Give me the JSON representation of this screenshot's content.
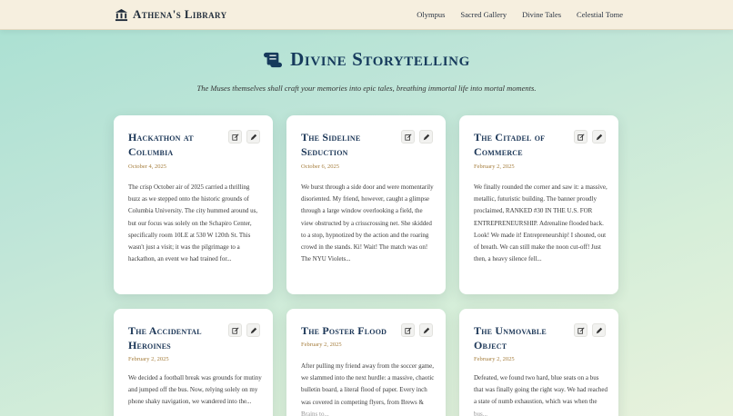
{
  "brand": {
    "name": "Athena's Library",
    "icon": "temple-icon"
  },
  "nav": [
    {
      "label": "Olympus"
    },
    {
      "label": "Sacred Gallery"
    },
    {
      "label": "Divine Tales"
    },
    {
      "label": "Celestial Tome"
    }
  ],
  "hero": {
    "title": "Divine Storytelling",
    "icon": "scroll-icon",
    "subtitle": "The Muses themselves shall craft your memories into epic tales, breathing immortal life into mortal moments."
  },
  "colors": {
    "accent": "#163a5c",
    "date": "#a57d3c",
    "nav_bg": "#f6efdf"
  },
  "stories": [
    {
      "title": "Hackathon at Columbia",
      "date": "October 4, 2025",
      "excerpt": "The crisp October air of 2025 carried a thrilling buzz as we stepped onto the historic grounds of Columbia University. The city hummed around us, but our focus was solely on the Schapiro Center, specifically room 10LE at 530 W 120th St. This wasn't just a visit; it was the pilgrimage to a hackathon, an event we had trained for..."
    },
    {
      "title": "The Sideline Seduction",
      "date": "October 6, 2025",
      "excerpt": "We burst through a side door and were momentarily disoriented. My friend, however, caught a glimpse through a large window overlooking a field, the view obstructed by a crisscrossing net. She skidded to a stop, hypnotized by the action and the roaring crowd in the stands. Ki! Wait! The match was on! The NYU Violets..."
    },
    {
      "title": "The Citadel of Commerce",
      "date": "February 2, 2025",
      "excerpt": "We finally rounded the corner and saw it: a massive, metallic, futuristic building. The banner proudly proclaimed, RANKED #30 IN THE U.S. FOR ENTREPRENEURSHIP. Adrenaline flooded back. Look! We made it! Entrepreneurship! I shouted, out of breath. We can still make the noon cut-off! Just then, a heavy silence fell..."
    },
    {
      "title": "The Accidental Heroines",
      "date": "February 2, 2025",
      "excerpt": "We decided a football break was grounds for mutiny and jumped off the bus. Now, relying solely on my phone shaky navigation, we wandered into the..."
    },
    {
      "title": "The Poster Flood",
      "date": "February 2, 2025",
      "excerpt": "After pulling my friend away from the soccer game, we slammed into the next hurdle: a massive, chaotic bulletin board, a literal flood of paper. Every inch was covered in competing flyers, from Brews & Brains to..."
    },
    {
      "title": "The Unmovable Object",
      "date": "February 2, 2025",
      "excerpt": "Defeated, we found two hard, blue seats on a bus that was finally going the right way. We had reached a state of numb exhaustion, which was when the bus..."
    }
  ]
}
